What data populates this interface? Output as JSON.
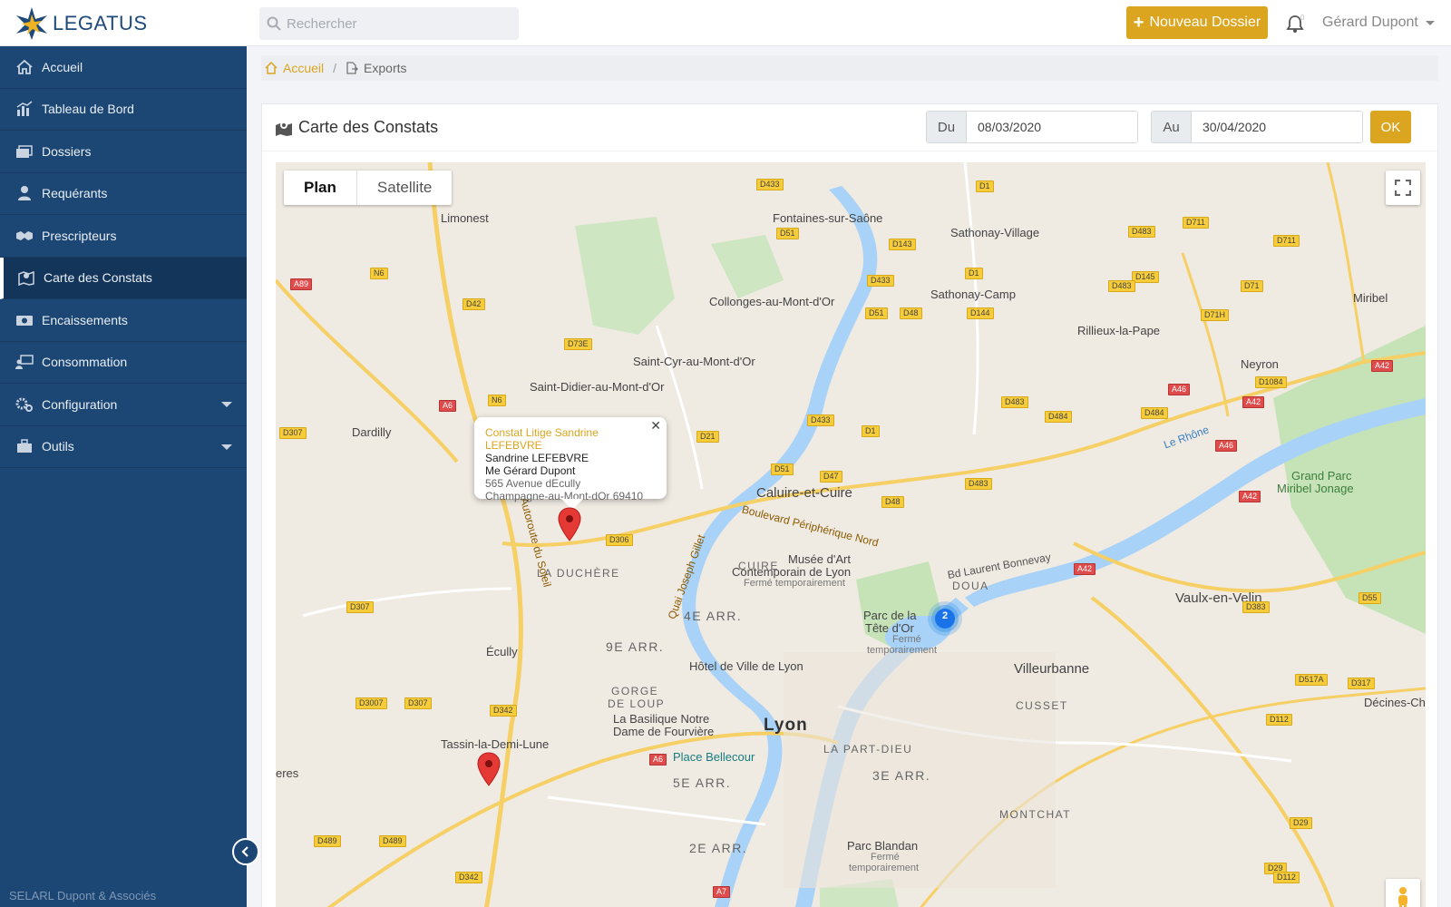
{
  "app": {
    "name": "LEGATUS"
  },
  "header": {
    "search_placeholder": "Rechercher",
    "new_button": "Nouveau Dossier",
    "notif_count": "0",
    "user_name": "Gérard Dupont"
  },
  "sidebar": {
    "items": [
      {
        "label": "Accueil",
        "icon": "home-icon"
      },
      {
        "label": "Tableau de Bord",
        "icon": "chart-icon"
      },
      {
        "label": "Dossiers",
        "icon": "folders-icon"
      },
      {
        "label": "Requérants",
        "icon": "user-icon"
      },
      {
        "label": "Prescripteurs",
        "icon": "handshake-icon"
      },
      {
        "label": "Carte des Constats",
        "icon": "map-icon"
      },
      {
        "label": "Encaissements",
        "icon": "money-icon"
      },
      {
        "label": "Consommation",
        "icon": "presentation-icon"
      },
      {
        "label": "Configuration",
        "icon": "gears-icon"
      },
      {
        "label": "Outils",
        "icon": "toolbox-icon"
      }
    ],
    "active_index": 5,
    "company": "SELARL Dupont & Associés"
  },
  "breadcrumb": {
    "home": "Accueil",
    "current": "Exports"
  },
  "card": {
    "title": "Carte des Constats",
    "from_label": "Du",
    "from_value": "08/03/2020",
    "to_label": "Au",
    "to_value": "30/04/2020",
    "ok_label": "OK"
  },
  "map": {
    "type_plan": "Plan",
    "type_satellite": "Satellite",
    "cluster_count": "2",
    "infowindow": {
      "title": "Constat Litige Sandrine LEFEBVRE",
      "name": "Sandrine LEFEBVRE",
      "lawyer": "Me Gérard Dupont",
      "street": "565 Avenue dEcully",
      "city": "Champagne-au-Mont-dOr 69410"
    },
    "labels": {
      "limonest": "Limonest",
      "fontaines": "Fontaines-sur-Saône",
      "sathonay_village": "Sathonay-Village",
      "sathonay_camp": "Sathonay-Camp",
      "collonges": "Collonges-au-Mont-d'Or",
      "rillieux": "Rillieux-la-Pape",
      "miribel": "Miribel",
      "neyron": "Neyron",
      "saint_cyr": "Saint-Cyr-au-Mont-d'Or",
      "saint_didier": "Saint-Didier-au-Mont-d'Or",
      "dardilly": "Dardilly",
      "caluire": "Caluire-et-Cuire",
      "cuire": "CUIRE",
      "la_duchere": "LA DUCHÈRE",
      "musee1": "Musée d'Art",
      "musee2": "Contemporain de Lyon",
      "musee3": "Fermé temporairement",
      "bd_laurent": "Bd Laurent Bonnevay",
      "doua": "DOUA",
      "vaulx": "Vaulx-en-Velin",
      "grand_parc1": "Grand Parc",
      "grand_parc2": "Miribel Jonage",
      "le_rhone": "Le Rhône",
      "quatre_arr": "4E ARR.",
      "neuf_arr": "9E ARR.",
      "parc_tete1": "Parc de la",
      "parc_tete2": "Tête d'Or",
      "parc_tete3": "Fermé",
      "parc_tete4": "temporairement",
      "ecully": "Écully",
      "hotel_ville": "Hôtel de Ville de Lyon",
      "villeurbanne": "Villeurbanne",
      "gorge1": "GORGE",
      "gorge2": "DE LOUP",
      "basilique1": "La Basilique Notre",
      "basilique2": "Dame de Fourvière",
      "lyon": "Lyon",
      "cusset": "CUSSET",
      "decines": "Décines-Charp",
      "tassin": "Tassin-la-Demi-Lune",
      "place_bellecour": "Place Bellecour",
      "part_dieu": "LA PART-DIEU",
      "cinq_arr": "5E ARR.",
      "trois_arr": "3E ARR.",
      "montchat": "MONTCHAT",
      "eres": "eres",
      "parc_blandan1": "Parc Blandan",
      "parc_blandan2": "Fermé",
      "parc_blandan3": "temporairement",
      "deux_arr": "2E ARR.",
      "bd_peripherique": "Boulevard Périphérique Nord",
      "quai_gillet": "Quai Joseph Gillet",
      "autoroute_soleil": "Autoroute du Soleil"
    },
    "shields": [
      "D433",
      "D1",
      "D51",
      "D143",
      "D483",
      "D711",
      "D711",
      "A89",
      "N6",
      "D1",
      "D433",
      "D145",
      "D71",
      "D42",
      "D483",
      "D51",
      "D48",
      "D144",
      "D71H",
      "D73E",
      "D1084",
      "A42",
      "A6",
      "N6",
      "A46",
      "D483",
      "D484",
      "D484",
      "A42",
      "D307",
      "D433",
      "D1",
      "A46",
      "D21",
      "D51",
      "D47",
      "D483",
      "D48",
      "A42",
      "D306",
      "A42",
      "D307",
      "D383",
      "D55",
      "D517A",
      "D317",
      "D3007",
      "D307",
      "D342",
      "D112",
      "A6",
      "D29",
      "D489",
      "D489",
      "D342",
      "D29",
      "D112",
      "A7"
    ]
  }
}
